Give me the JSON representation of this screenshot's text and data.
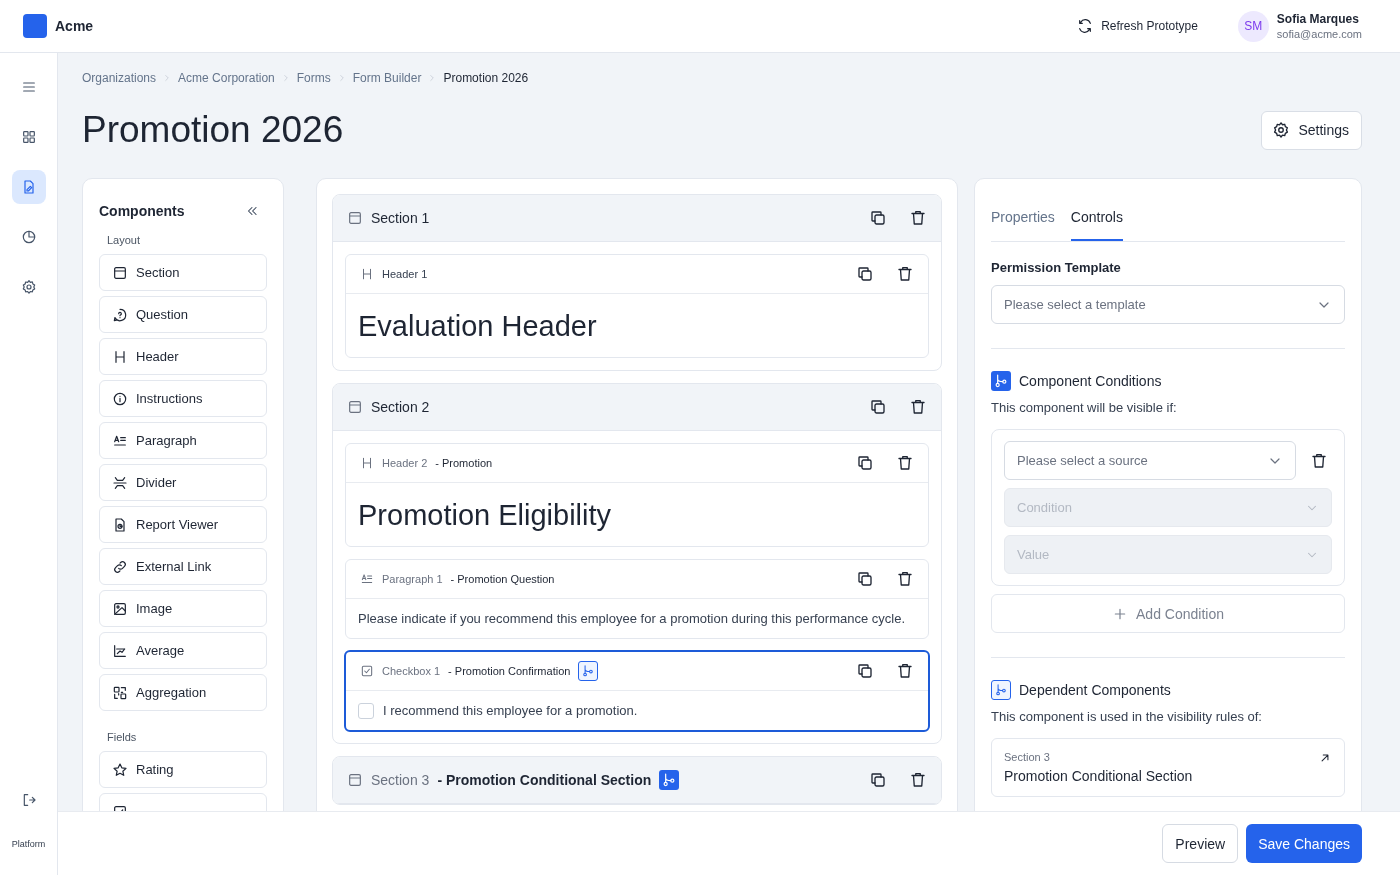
{
  "app": {
    "name": "Acme"
  },
  "topbar": {
    "refresh_label": "Refresh Prototype",
    "user": {
      "initials": "SM",
      "name": "Sofia Marques",
      "email": "sofia@acme.com"
    }
  },
  "rail": {
    "items": [
      {
        "selected": false
      },
      {
        "selected": false
      },
      {
        "selected": true
      },
      {
        "selected": false
      },
      {
        "selected": false
      }
    ],
    "footer_label": "Platform"
  },
  "breadcrumb": [
    "Organizations",
    "Acme Corporation",
    "Forms",
    "Form Builder",
    "Promotion 2026"
  ],
  "title": "Promotion 2026",
  "settings_button": "Settings",
  "components_panel": {
    "title": "Components",
    "groups": [
      {
        "label": "Layout",
        "items": [
          {
            "kind": "section",
            "label": "Section"
          },
          {
            "kind": "question",
            "label": "Question"
          },
          {
            "kind": "header",
            "label": "Header"
          },
          {
            "kind": "info",
            "label": "Instructions"
          },
          {
            "kind": "paragraph",
            "label": "Paragraph"
          },
          {
            "kind": "divider",
            "label": "Divider"
          },
          {
            "kind": "report",
            "label": "Report Viewer"
          },
          {
            "kind": "link",
            "label": "External Link"
          },
          {
            "kind": "image",
            "label": "Image"
          },
          {
            "kind": "average",
            "label": "Average"
          },
          {
            "kind": "aggregation",
            "label": "Aggregation"
          }
        ]
      },
      {
        "label": "Fields",
        "items": [
          {
            "kind": "star",
            "label": "Rating"
          },
          {
            "kind": "checkbox"
          }
        ]
      }
    ]
  },
  "canvas": {
    "sections": [
      {
        "label": "Section 1",
        "conditional": false,
        "components": [
          {
            "kind": "header",
            "label": "Header 1",
            "selected": false,
            "conditional": false,
            "content": "Evaluation Header"
          }
        ]
      },
      {
        "label": "Section 2",
        "conditional": false,
        "components": [
          {
            "kind": "header",
            "label": "Header 2",
            "name": "- Promotion",
            "selected": false,
            "conditional": false,
            "content": "Promotion Eligibility"
          },
          {
            "kind": "paragraph",
            "label": "Paragraph 1",
            "name": "- Promotion Question",
            "selected": false,
            "conditional": false,
            "content": "Please indicate if you recommend this employee for a promotion during this performance cycle."
          },
          {
            "kind": "checkbox",
            "label": "Checkbox 1",
            "name": "- Promotion Confirmation",
            "selected": true,
            "conditional": true,
            "checked": false,
            "content": "I recommend this employee for a promotion."
          }
        ]
      },
      {
        "label": "Section 3",
        "name": "- Promotion Conditional Section",
        "conditional": true
      }
    ]
  },
  "properties": {
    "tabs": [
      {
        "label": "Properties",
        "selected": false
      },
      {
        "label": "Controls",
        "selected": true
      }
    ],
    "permission": {
      "label": "Permission Template",
      "placeholder": "Please select a template"
    },
    "conditions": {
      "title": "Component Conditions",
      "description": "This component will be visible if:",
      "source_placeholder": "Please select a source",
      "condition_placeholder": "Condition",
      "value_placeholder": "Value",
      "add_label": "Add Condition"
    },
    "dependents": {
      "title": "Dependent Components",
      "description": "This component is used in the visibility rules of:",
      "items": [
        {
          "kicker": "Section 3",
          "title": "Promotion Conditional Section"
        }
      ]
    }
  },
  "footer": {
    "buttons": [
      {
        "label": "Preview",
        "kind": "secondary"
      },
      {
        "label": "Save Changes",
        "kind": "primary"
      }
    ]
  }
}
